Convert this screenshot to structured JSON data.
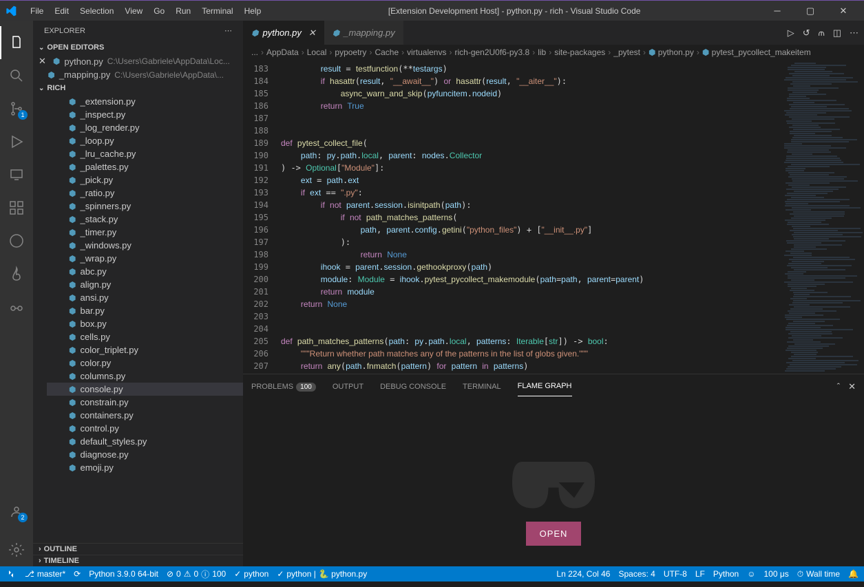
{
  "menu": [
    "File",
    "Edit",
    "Selection",
    "View",
    "Go",
    "Run",
    "Terminal",
    "Help"
  ],
  "windowTitle": "[Extension Development Host] - python.py - rich - Visual Studio Code",
  "explorer": {
    "title": "EXPLORER",
    "openEditorsTitle": "OPEN EDITORS",
    "openEditors": [
      {
        "name": "python.py",
        "path": "C:\\Users\\Gabriele\\AppData\\Loc...",
        "active": true,
        "close": true
      },
      {
        "name": "_mapping.py",
        "path": "C:\\Users\\Gabriele\\AppData\\...",
        "active": false,
        "close": false
      }
    ],
    "folderTitle": "RICH",
    "files": [
      "_extension.py",
      "_inspect.py",
      "_log_render.py",
      "_loop.py",
      "_lru_cache.py",
      "_palettes.py",
      "_pick.py",
      "_ratio.py",
      "_spinners.py",
      "_stack.py",
      "_timer.py",
      "_windows.py",
      "_wrap.py",
      "abc.py",
      "align.py",
      "ansi.py",
      "bar.py",
      "box.py",
      "cells.py",
      "color_triplet.py",
      "color.py",
      "columns.py",
      "console.py",
      "constrain.py",
      "containers.py",
      "control.py",
      "default_styles.py",
      "diagnose.py",
      "emoji.py"
    ],
    "selectedFile": "console.py",
    "outline": "OUTLINE",
    "timeline": "TIMELINE"
  },
  "tabs": [
    {
      "name": "python.py",
      "active": true,
      "close": true
    },
    {
      "name": "_mapping.py",
      "active": false,
      "close": false
    }
  ],
  "breadcrumb": [
    "...",
    "AppData",
    "Local",
    "pypoetry",
    "Cache",
    "virtualenvs",
    "rich-gen2U0f6-py3.8",
    "lib",
    "site-packages",
    "_pytest",
    "python.py",
    "pytest_pycollect_makeitem"
  ],
  "codeStart": 183,
  "panel": {
    "tabs": [
      {
        "label": "PROBLEMS",
        "count": "100"
      },
      {
        "label": "OUTPUT"
      },
      {
        "label": "DEBUG CONSOLE"
      },
      {
        "label": "TERMINAL"
      },
      {
        "label": "FLAME GRAPH",
        "active": true
      }
    ],
    "openBtn": "OPEN"
  },
  "status": {
    "branch": "master*",
    "python": "Python 3.9.0 64-bit",
    "errors": "0",
    "warnings": "0",
    "info": "100",
    "task1": "python",
    "task2": "python | ",
    "task2file": "python.py",
    "cursor": "Ln 224, Col 46",
    "spaces": "Spaces: 4",
    "encoding": "UTF-8",
    "eol": "LF",
    "lang": "Python",
    "feedback": "",
    "time": "100 μs",
    "wall": "Wall time"
  },
  "activityBadges": {
    "scm": "1",
    "accounts": "2"
  }
}
